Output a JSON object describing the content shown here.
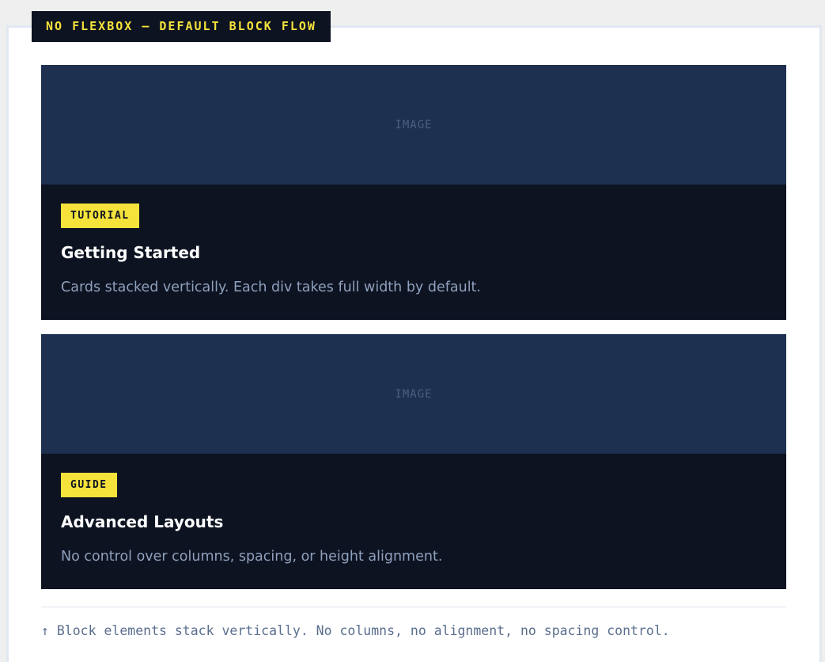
{
  "header": {
    "label": "NO FLEXBOX — DEFAULT BLOCK FLOW"
  },
  "cards": [
    {
      "image_placeholder": "IMAGE",
      "tag": "TUTORIAL",
      "title": "Getting Started",
      "description": "Cards stacked vertically. Each div takes full width by default."
    },
    {
      "image_placeholder": "IMAGE",
      "tag": "GUIDE",
      "title": "Advanced Layouts",
      "description": "No control over columns, spacing, or height alignment."
    }
  ],
  "footer": {
    "caption": "↑ Block elements stack vertically. No columns, no alignment, no spacing control."
  },
  "colors": {
    "accent": "#f5e23b",
    "card_background": "#0d1321",
    "image_background": "#1e3050"
  }
}
